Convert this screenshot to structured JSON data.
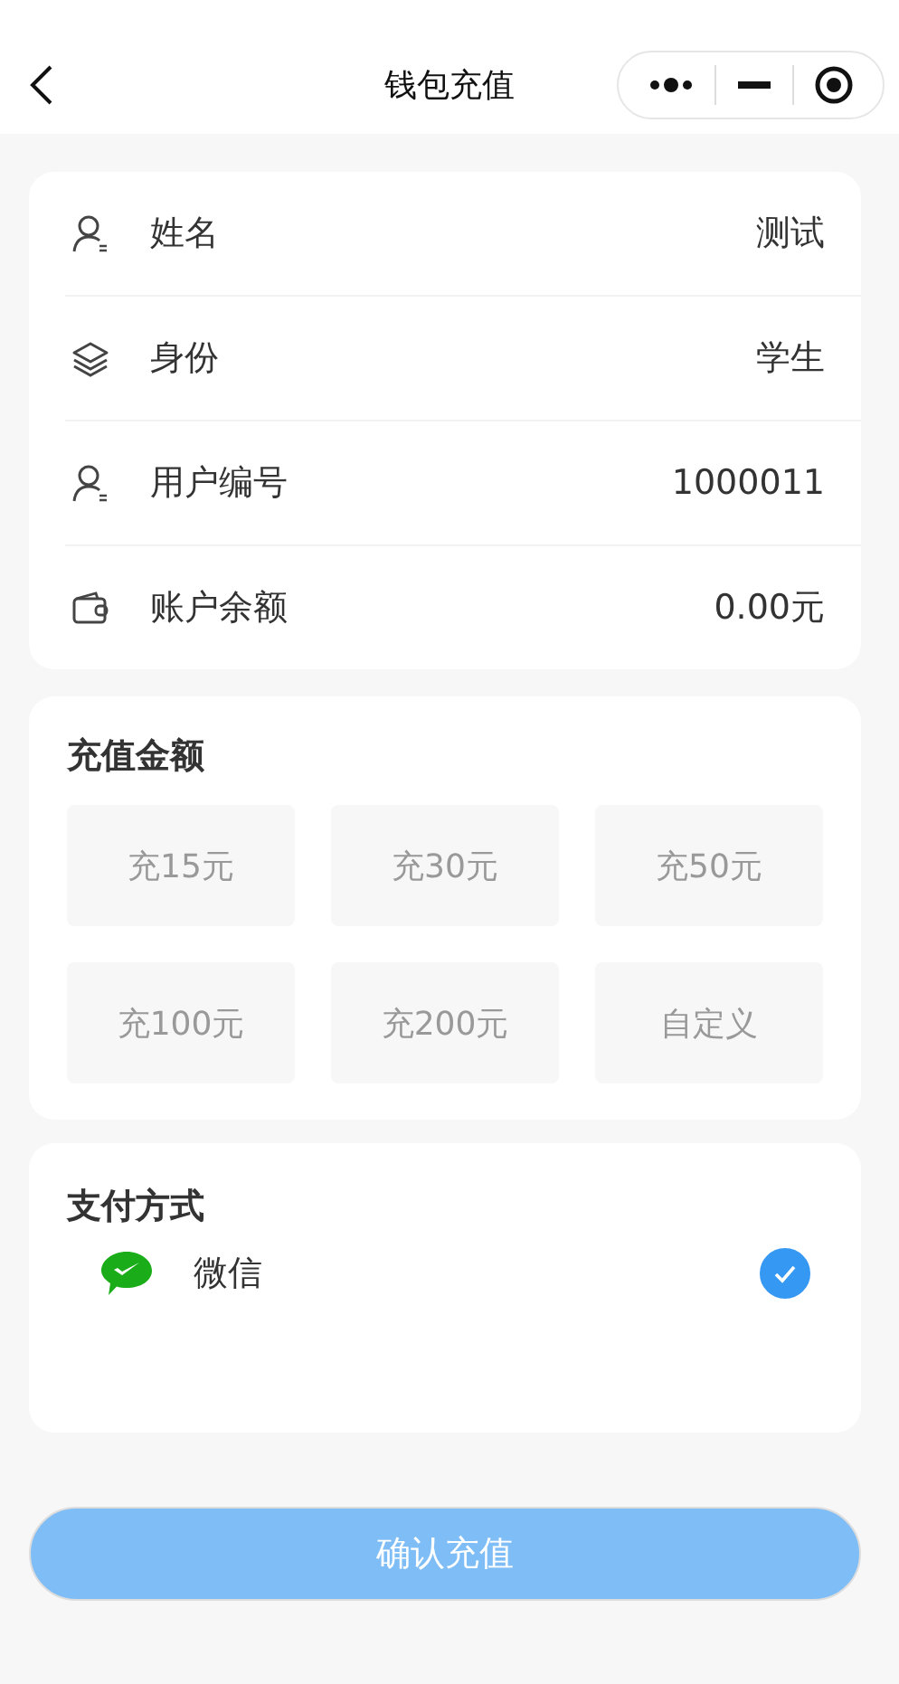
{
  "nav_bar": {
    "title": "钱包充值"
  },
  "info_rows": [
    {
      "kind": "user",
      "label": "姓名",
      "value": "测试"
    },
    {
      "kind": "identity",
      "label": "身份",
      "value": "学生"
    },
    {
      "kind": "user",
      "label": "用户编号",
      "value": "1000011"
    },
    {
      "kind": "balance",
      "label": "账户余额",
      "value": "0.00元"
    }
  ],
  "amount_section": {
    "title": "充值金额",
    "options": [
      {
        "label": "充15元",
        "selected": false
      },
      {
        "label": "充30元",
        "selected": false
      },
      {
        "label": "充50元",
        "selected": false
      },
      {
        "label": "充100元",
        "selected": false
      },
      {
        "label": "充200元",
        "selected": false
      },
      {
        "label": "自定义",
        "selected": false
      }
    ]
  },
  "payment_section": {
    "title": "支付方式",
    "methods": [
      {
        "label": "微信",
        "selected": true
      }
    ]
  },
  "confirm_button": {
    "label": "确认充值",
    "disabled": true
  }
}
